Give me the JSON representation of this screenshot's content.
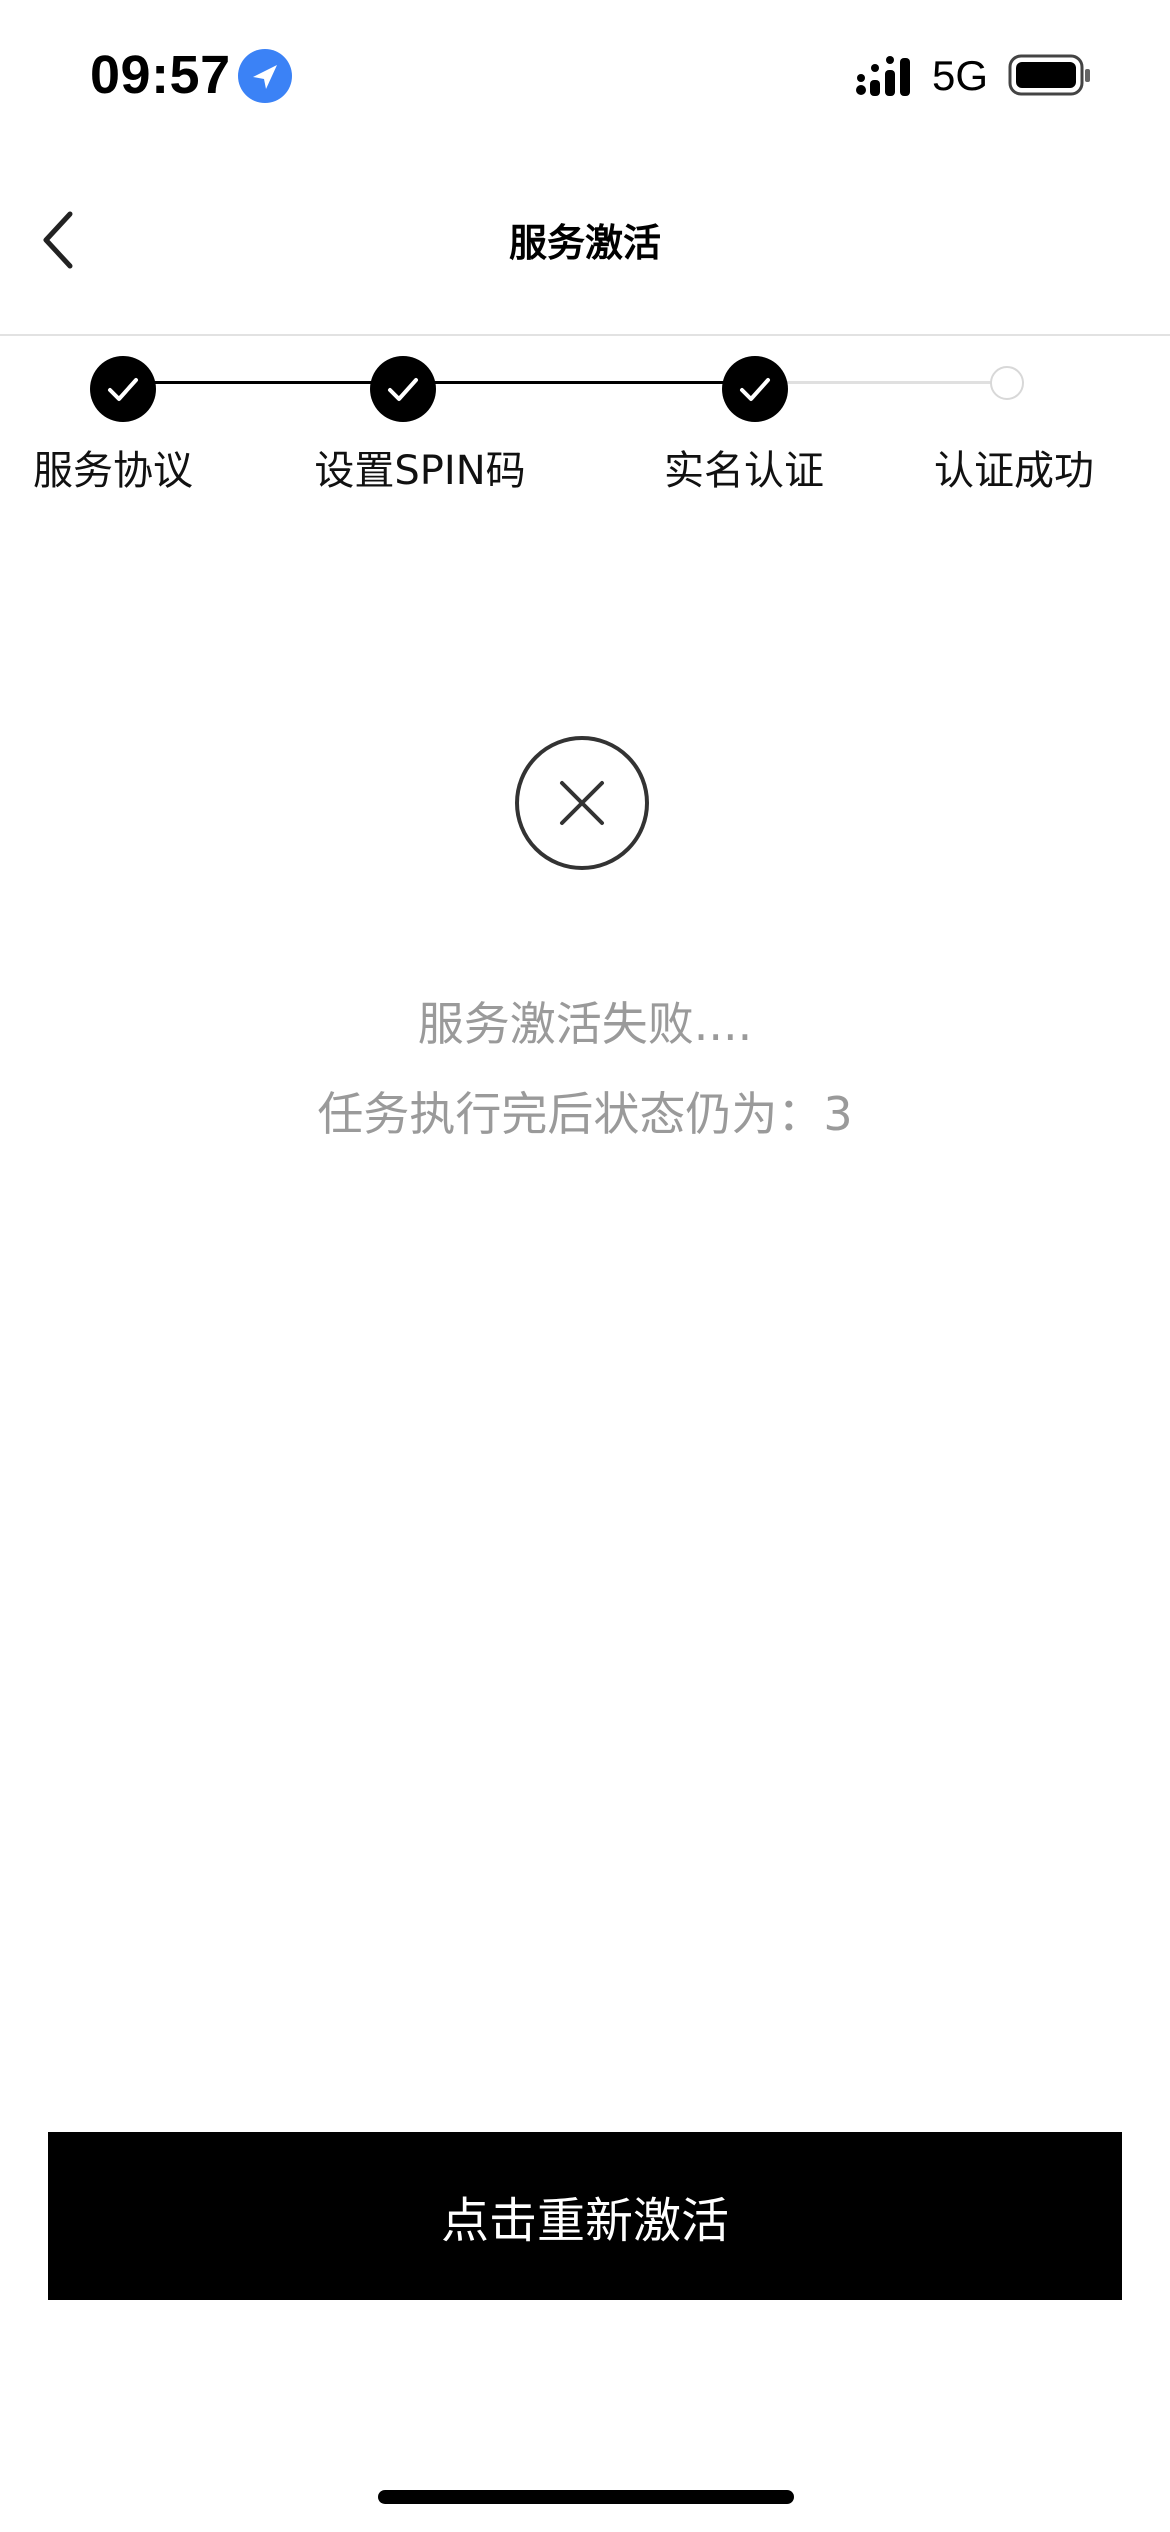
{
  "status_bar": {
    "time": "09:57",
    "network": "5G",
    "icons": [
      "location-arrow-icon",
      "signal-bars-icon",
      "battery-icon"
    ]
  },
  "nav": {
    "title": "服务激活",
    "back_icon": "chevron-left-icon"
  },
  "stepper": {
    "steps": [
      {
        "label": "服务协议",
        "status": "done"
      },
      {
        "label": "设置SPIN码",
        "status": "done"
      },
      {
        "label": "实名认证",
        "status": "done"
      },
      {
        "label": "认证成功",
        "status": "pending"
      }
    ]
  },
  "result": {
    "icon": "close-circle-icon",
    "title": "服务激活失败....",
    "detail": "任务执行完后状态仍为：3"
  },
  "actions": {
    "reactivate_label": "点击重新激活"
  },
  "colors": {
    "accent": "#000000",
    "muted_text": "#9a9a9a",
    "location_badge": "#3b82f6"
  }
}
